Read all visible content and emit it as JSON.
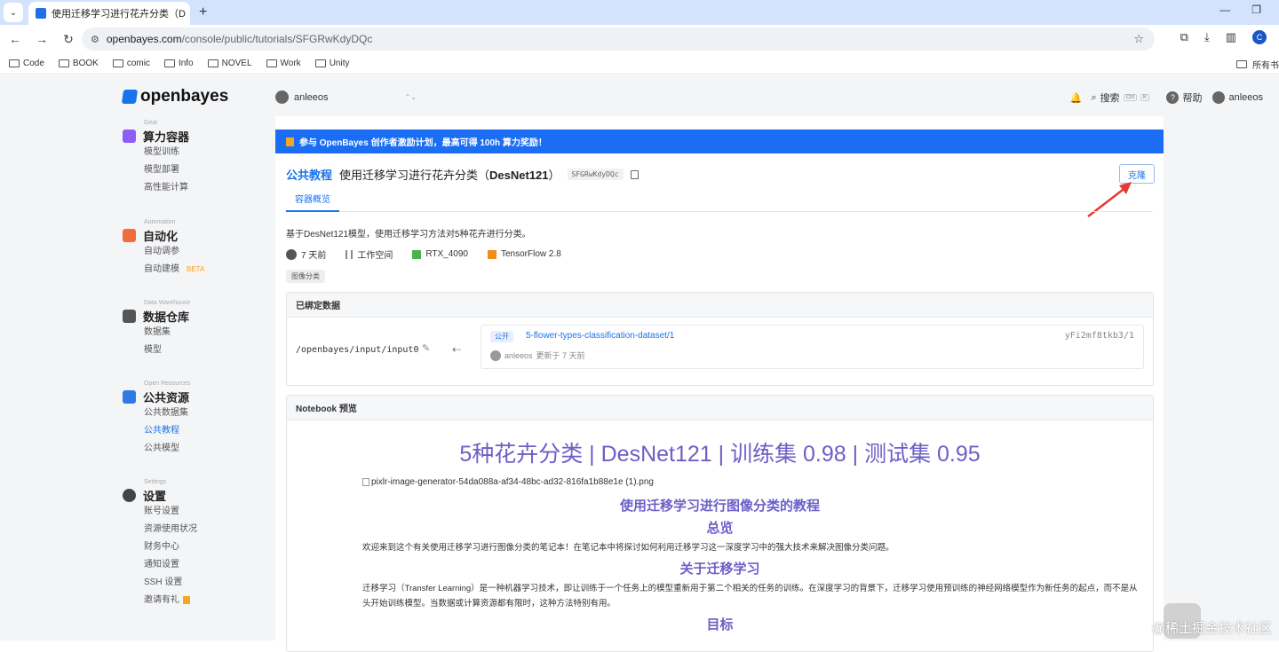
{
  "browser": {
    "tab_title": "使用迁移学习进行花卉分类（D",
    "url_host": "openbayes.com",
    "url_path": "/console/public/tutorials/SFGRwKdyDQc",
    "profile_initial": "C",
    "bookmarks": [
      "Code",
      "BOOK",
      "comic",
      "Info",
      "NOVEL",
      "Work",
      "Unity"
    ],
    "bookmarks_right": "所有书"
  },
  "app": {
    "logo": "openbayes",
    "user": "anleeos",
    "search": "搜索",
    "kbd_ctrl": "Ctrl",
    "kbd_k": "K",
    "help": "帮助",
    "account": "anleeos"
  },
  "sidebar": {
    "sections": [
      {
        "eyebrow": "Gear",
        "title": "算力容器",
        "items": [
          "模型训练",
          "模型部署",
          "高性能计算"
        ]
      },
      {
        "eyebrow": "Automation",
        "title": "自动化",
        "items": [
          "自动调参",
          "自动建模"
        ],
        "beta": "BETA"
      },
      {
        "eyebrow": "Data Warehouse",
        "title": "数据仓库",
        "items": [
          "数据集",
          "模型"
        ]
      },
      {
        "eyebrow": "Open Resources",
        "title": "公共资源",
        "items": [
          "公共数据集",
          "公共教程",
          "公共模型"
        ]
      },
      {
        "eyebrow": "Settings",
        "title": "设置",
        "items": [
          "账号设置",
          "资源使用状况",
          "财务中心",
          "通知设置",
          "SSH 设置",
          "邀请有礼"
        ]
      }
    ]
  },
  "banner": "参与 OpenBayes 创作者激励计划，最高可得 100h 算力奖励！",
  "header": {
    "crumb": "公共教程",
    "title_pre": "使用迁移学习进行花卉分类（",
    "title_bold": "DesNet121",
    "title_post": "）",
    "id": "SFGRwKdyDQc",
    "clone": "克隆",
    "tab": "容器概览"
  },
  "overview": {
    "description": "基于DesNet121模型，使用迁移学习方法对5种花卉进行分类。",
    "time": "7 天前",
    "workspace": "工作空间",
    "gpu": "RTX_4090",
    "framework": "TensorFlow 2.8",
    "tag": "图像分类"
  },
  "binding": {
    "header": "已绑定数据",
    "path": "/openbayes/input/input0",
    "public": "公开",
    "dataset": "5-flower-types-classification-dataset/1",
    "version": "yFi2mf8tkb3/1",
    "owner": "anleeos",
    "updated": "更新于 7 天前"
  },
  "notebook": {
    "header": "Notebook 预览",
    "title": "5种花卉分类 | DesNet121 | 训练集 0.98 | 测试集 0.95",
    "image_alt": "pixlr-image-generator-54da088a-af34-48bc-ad32-816fa1b88e1e (1).png",
    "h2": "使用迁移学习进行图像分类的教程",
    "h3_overview": "总览",
    "p_overview": "欢迎来到这个有关使用迁移学习进行图像分类的笔记本！在笔记本中将探讨如何利用迁移学习这一深度学习中的强大技术来解决图像分类问题。",
    "h3_about": "关于迁移学习",
    "p_about": "迁移学习（Transfer Learning）是一种机器学习技术，即让训练于一个任务上的模型重新用于第二个相关的任务的训练。在深度学习的背景下，迁移学习使用预训练的神经网络模型作为新任务的起点，而不是从头开始训练模型。当数据或计算资源都有限时，这种方法特别有用。",
    "h3_goal": "目标"
  },
  "watermark": "@稀土掘金技术社区",
  "colors": {
    "accent": "#1a73e8",
    "banner": "#1b6ef3",
    "notebook_heading": "#6c5fc7",
    "arrow": "#e53935"
  }
}
